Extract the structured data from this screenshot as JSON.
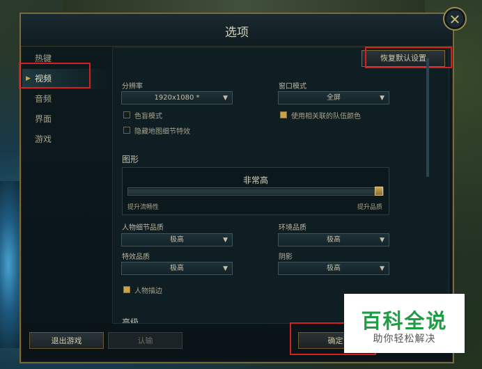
{
  "window": {
    "title": "选项",
    "close_icon": "✕"
  },
  "nav": {
    "items": [
      "热键",
      "视频",
      "音频",
      "界面",
      "游戏"
    ],
    "active_index": 1
  },
  "reset_label": "恢复默认设置",
  "resolution": {
    "label": "分辨率",
    "value": "1920x1080 *"
  },
  "window_mode": {
    "label": "窗口模式",
    "value": "全屏"
  },
  "colorblind": {
    "label": "色盲模式",
    "checked": false
  },
  "hide_map_fx": {
    "label": "隐藏地图细节特效",
    "checked": false
  },
  "team_colors": {
    "label": "使用相关联的队伍颜色",
    "checked": true
  },
  "graphics": {
    "title": "图形",
    "value": "非常高",
    "level_fraction": 1.0,
    "min_label": "提升流畅性",
    "max_label": "提升品质"
  },
  "char_quality": {
    "label": "人物细节品质",
    "value": "极高"
  },
  "env_quality": {
    "label": "环境品质",
    "value": "极高"
  },
  "fx_quality": {
    "label": "特效品质",
    "value": "极高"
  },
  "shadows": {
    "label": "阴影",
    "value": "极高"
  },
  "outline": {
    "label": "人物描边",
    "checked": true
  },
  "advanced_title": "高级",
  "buttons": {
    "quit": "退出游戏",
    "surrender": "认输",
    "confirm": "确定"
  },
  "watermark": {
    "main": "百科全说",
    "sub": "助你轻松解决"
  }
}
